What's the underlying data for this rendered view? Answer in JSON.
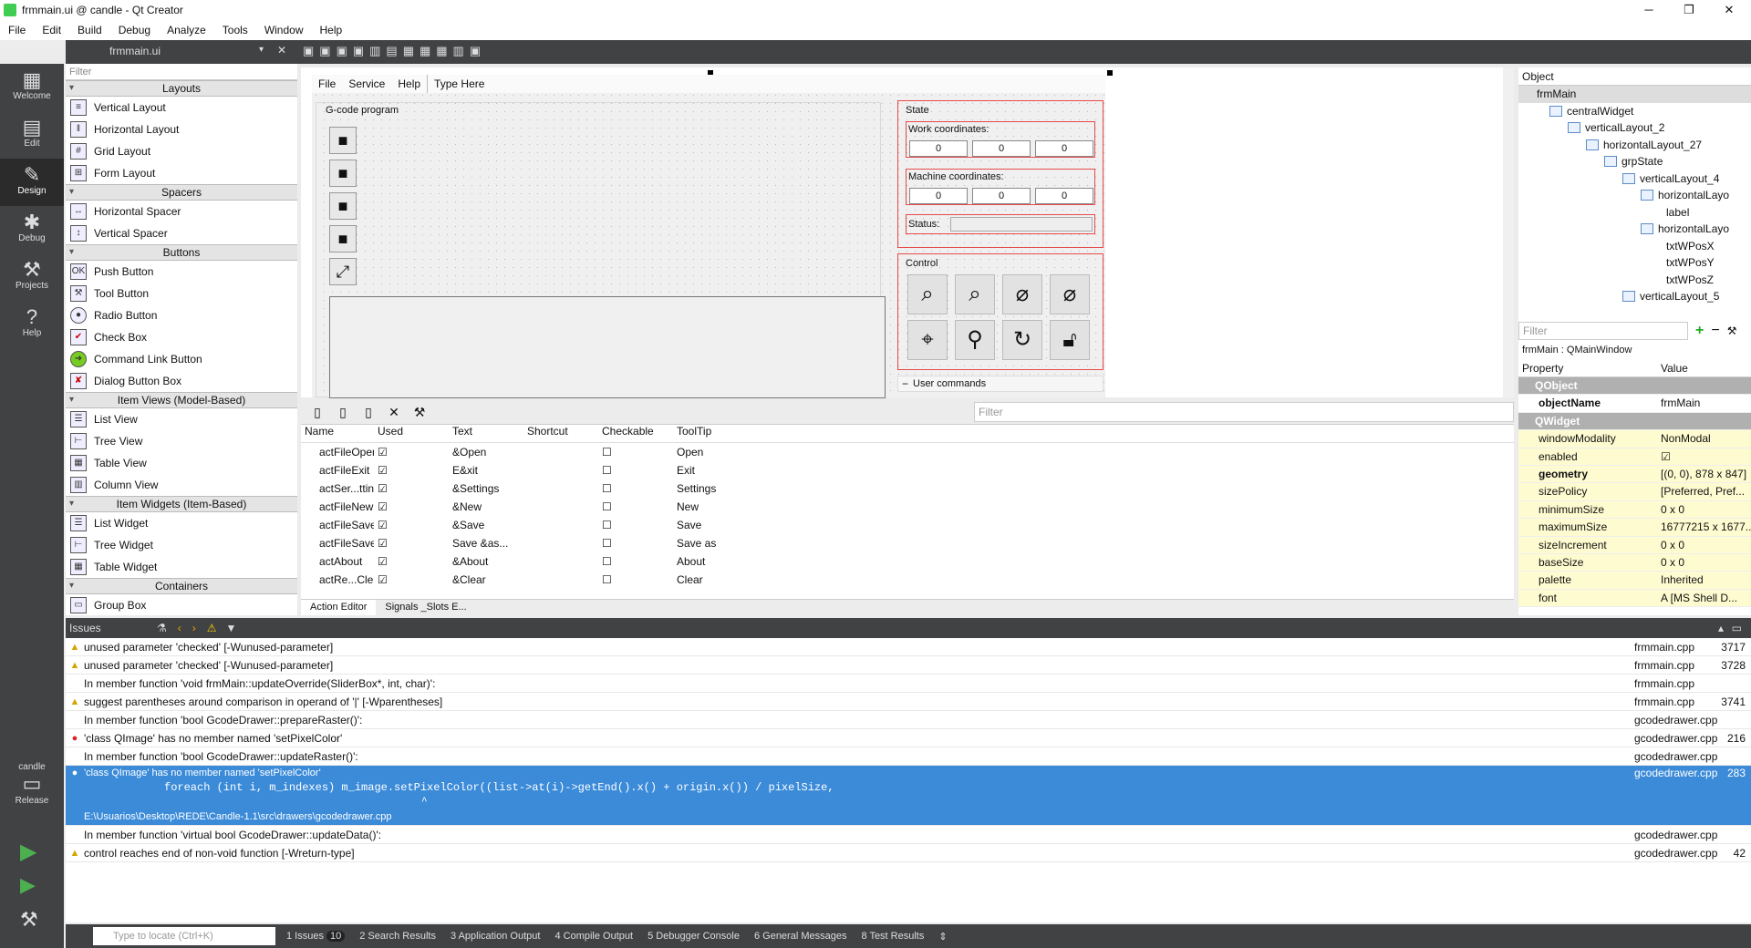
{
  "window": {
    "title": "frmmain.ui @ candle - Qt Creator",
    "minimize": "─",
    "maximize": "❐",
    "close": "✕"
  },
  "menu": [
    "File",
    "Edit",
    "Build",
    "Debug",
    "Analyze",
    "Tools",
    "Window",
    "Help"
  ],
  "editor": {
    "file_tab": "frmmain.ui"
  },
  "modes": [
    {
      "label": "Welcome",
      "icon": "grid-icon"
    },
    {
      "label": "Edit",
      "icon": "edit-icon"
    },
    {
      "label": "Design",
      "icon": "pencil-icon"
    },
    {
      "label": "Debug",
      "icon": "bug-icon"
    },
    {
      "label": "Projects",
      "icon": "wrench-icon"
    },
    {
      "label": "Help",
      "icon": "help-icon"
    }
  ],
  "kit": {
    "project": "candle",
    "config": "Release"
  },
  "widgetbox": {
    "filter_placeholder": "Filter",
    "categories": {
      "layouts": "Layouts",
      "spacers": "Spacers",
      "buttons": "Buttons",
      "item_views": "Item Views (Model-Based)",
      "item_widgets": "Item Widgets (Item-Based)",
      "containers": "Containers"
    },
    "layouts": [
      "Vertical Layout",
      "Horizontal Layout",
      "Grid Layout",
      "Form Layout"
    ],
    "spacers": [
      "Horizontal Spacer",
      "Vertical Spacer"
    ],
    "buttons": [
      "Push Button",
      "Tool Button",
      "Radio Button",
      "Check Box",
      "Command Link Button",
      "Dialog Button Box"
    ],
    "item_views": [
      "List View",
      "Tree View",
      "Table View",
      "Column View"
    ],
    "item_widgets": [
      "List Widget",
      "Tree Widget",
      "Table Widget"
    ],
    "containers": [
      "Group Box"
    ]
  },
  "form": {
    "menu": [
      "File",
      "Service",
      "Help",
      "Type Here"
    ],
    "gcode_title": "G-code program",
    "state_title": "State",
    "work_coords_label": "Work coordinates:",
    "machine_coords_label": "Machine coordinates:",
    "work_coords": [
      "0",
      "0",
      "0"
    ],
    "machine_coords": [
      "0",
      "0",
      "0"
    ],
    "status_label": "Status:",
    "control_title": "Control",
    "user_commands": "User commands"
  },
  "object_inspector": {
    "header": "Object",
    "tree": [
      "frmMain",
      "centralWidget",
      "verticalLayout_2",
      "horizontalLayout_27",
      "grpState",
      "verticalLayout_4",
      "horizontalLayo",
      "label",
      "horizontalLayo",
      "txtWPosX",
      "txtWPosY",
      "txtWPosZ",
      "verticalLayout_5"
    ]
  },
  "property_editor": {
    "filter_placeholder": "Filter",
    "class_label": "frmMain : QMainWindow",
    "col_property": "Property",
    "col_value": "Value",
    "rows": [
      {
        "k": "QObject",
        "v": "",
        "type": "sec"
      },
      {
        "k": "objectName",
        "v": "frmMain",
        "type": "bold"
      },
      {
        "k": "QWidget",
        "v": "",
        "type": "sec"
      },
      {
        "k": "windowModality",
        "v": "NonModal",
        "type": "y"
      },
      {
        "k": "enabled",
        "v": "☑",
        "type": "y"
      },
      {
        "k": "geometry",
        "v": "[(0, 0), 878 x 847]",
        "type": "boldy"
      },
      {
        "k": "sizePolicy",
        "v": "[Preferred, Pref...",
        "type": "y"
      },
      {
        "k": "minimumSize",
        "v": "0 x 0",
        "type": "y"
      },
      {
        "k": "maximumSize",
        "v": "16777215 x 1677...",
        "type": "y"
      },
      {
        "k": "sizeIncrement",
        "v": "0 x 0",
        "type": "y"
      },
      {
        "k": "baseSize",
        "v": "0 x 0",
        "type": "y"
      },
      {
        "k": "palette",
        "v": "Inherited",
        "type": "y"
      },
      {
        "k": "font",
        "v": "A [MS Shell D...",
        "type": "y"
      }
    ]
  },
  "action_editor": {
    "filter_placeholder": "Filter",
    "headers": [
      "Name",
      "Used",
      "Text",
      "Shortcut",
      "Checkable",
      "ToolTip"
    ],
    "rows": [
      [
        "actFileOpen",
        "☑",
        "&Open",
        "",
        "☐",
        "Open"
      ],
      [
        "actFileExit",
        "☑",
        "E&xit",
        "",
        "☐",
        "Exit"
      ],
      [
        "actSer...ttings",
        "☑",
        "&Settings",
        "",
        "☐",
        "Settings"
      ],
      [
        "actFileNew",
        "☑",
        "&New",
        "",
        "☐",
        "New"
      ],
      [
        "actFileSave",
        "☑",
        "&Save",
        "",
        "☐",
        "Save"
      ],
      [
        "actFileSaveAs",
        "☑",
        "Save &as...",
        "",
        "☐",
        "Save as"
      ],
      [
        "actAbout",
        "☑",
        "&About",
        "",
        "☐",
        "About"
      ],
      [
        "actRe...Clear",
        "☑",
        "&Clear",
        "",
        "☐",
        "Clear"
      ]
    ],
    "tabs": [
      "Action Editor",
      "Signals _Slots E..."
    ]
  },
  "issues": {
    "title": "Issues",
    "rows": [
      {
        "icon": "warn",
        "msg": "unused parameter 'checked' [-Wunused-parameter]",
        "file": "frmmain.cpp",
        "line": "3717"
      },
      {
        "icon": "warn",
        "msg": "unused parameter 'checked' [-Wunused-parameter]",
        "file": "frmmain.cpp",
        "line": "3728"
      },
      {
        "icon": "",
        "msg": "In member function 'void frmMain::updateOverride(SliderBox*, int, char)':",
        "file": "frmmain.cpp",
        "line": ""
      },
      {
        "icon": "warn",
        "msg": "suggest parentheses around comparison in operand of '|' [-Wparentheses]",
        "file": "frmmain.cpp",
        "line": "3741"
      },
      {
        "icon": "",
        "msg": "In member function 'bool GcodeDrawer::prepareRaster()':",
        "file": "gcodedrawer.cpp",
        "line": ""
      },
      {
        "icon": "err",
        "msg": "'class QImage' has no member named 'setPixelColor'",
        "file": "gcodedrawer.cpp",
        "line": "216"
      },
      {
        "icon": "",
        "msg": "In member function 'bool GcodeDrawer::updateRaster()':",
        "file": "gcodedrawer.cpp",
        "line": ""
      }
    ],
    "selected": {
      "msg": "'class QImage' has no member named 'setPixelColor'",
      "code": "foreach (int i, m_indexes) m_image.setPixelColor((list->at(i)->getEnd().x() + origin.x()) / pixelSize,",
      "caret": "^",
      "path": "E:\\Usuarios\\Desktop\\REDE\\Candle-1.1\\src\\drawers\\gcodedrawer.cpp",
      "file": "gcodedrawer.cpp",
      "line": "283"
    },
    "rows2": [
      {
        "icon": "",
        "msg": "In member function 'virtual bool GcodeDrawer::updateData()':",
        "file": "gcodedrawer.cpp",
        "line": ""
      },
      {
        "icon": "warn",
        "msg": "control reaches end of non-void function [-Wreturn-type]",
        "file": "gcodedrawer.cpp",
        "line": "42"
      }
    ]
  },
  "statusbar": {
    "locate_placeholder": "Type to locate (Ctrl+K)",
    "panes": [
      "1  Issues",
      "2  Search Results",
      "3  Application Output",
      "4  Compile Output",
      "5  Debugger Console",
      "6  General Messages",
      "8  Test Results"
    ],
    "issues_count": "10"
  }
}
